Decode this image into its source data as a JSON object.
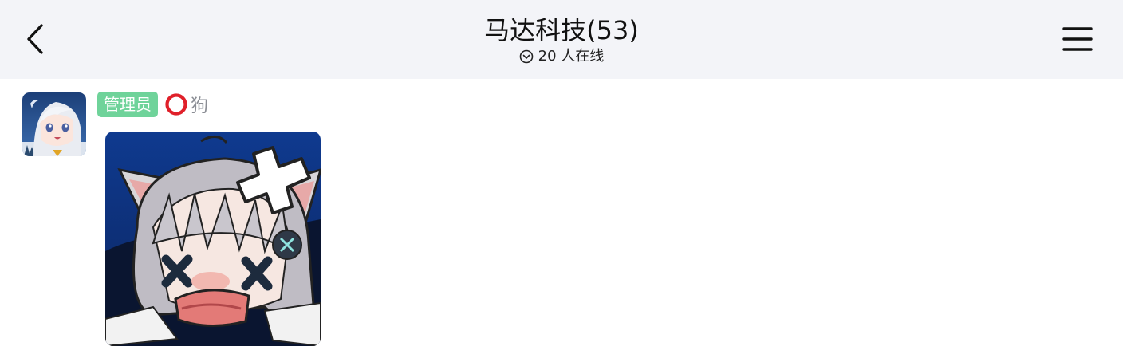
{
  "header": {
    "title": "马达科技(53)",
    "online_text": "20 人在线",
    "icons": {
      "back": "chevron-left-icon",
      "menu": "hamburger-menu-icon",
      "online": "chevron-down-circle-icon"
    }
  },
  "message": {
    "role_badge": "管理员",
    "sender_name": "狗",
    "name_prefix_icon": "red-circle-icon",
    "avatar": "anime-avatar",
    "sticker": "cat-girl-sticker"
  },
  "colors": {
    "header_bg": "#f3f4f8",
    "badge_bg": "#6fd39a",
    "name_text": "#8a8d94",
    "ring": "#e0202a"
  }
}
